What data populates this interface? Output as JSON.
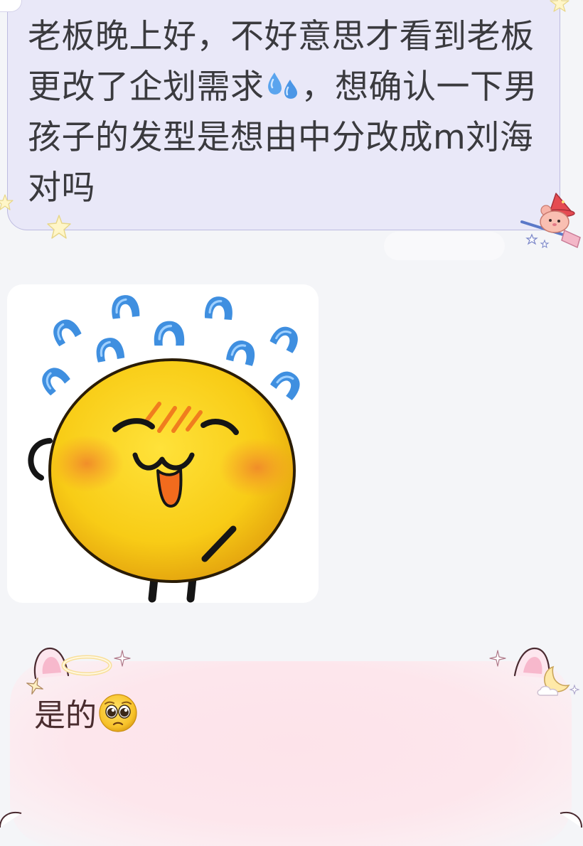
{
  "conversation": {
    "incoming_message": {
      "text_part1": "老板晚上好，不好意思才看到老板更改了企划需求",
      "emoji_inline": "sweat-droplets-icon",
      "text_part2": "，想确认一下男孩子的发型是想由中分改成m刘海对吗"
    },
    "sticker": {
      "icon": "sweating-smiling-yellow-face-sticker"
    },
    "outgoing_message": {
      "text": "是的",
      "emoji": "pleading-face-icon"
    }
  },
  "theme": {
    "background": "#f4f5f8",
    "incoming_bubble": "#e9e8f8",
    "incoming_border": "#bdbbe0",
    "outgoing_bubble": "#fde3ea",
    "text_color": "#3a3a3e"
  }
}
